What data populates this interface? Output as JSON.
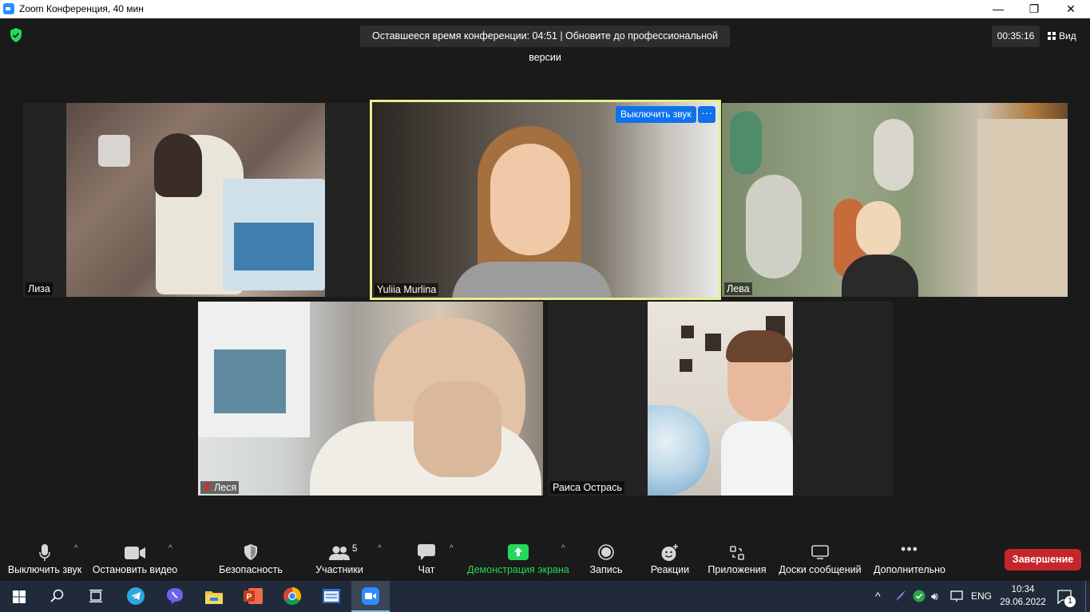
{
  "window": {
    "title": "Zoom Конференция, 40 мин",
    "minimize_glyph": "—",
    "maximize_glyph": "❐",
    "close_glyph": "✕"
  },
  "meeting": {
    "banner": "Оставшееся время конференции: 04:51 | Обновите до профессиональной версии",
    "elapsed": "00:35:16",
    "view_label": "Вид",
    "security_icon": "shield-check-icon",
    "security_color": "#23d959"
  },
  "participants": [
    {
      "name": "Лиза",
      "muted": false
    },
    {
      "name": "Yuliia Murlina",
      "muted": false,
      "active_speaker": true
    },
    {
      "name": "Лева",
      "muted": false
    },
    {
      "name": "Леся",
      "muted": true
    },
    {
      "name": "Раиса Острась",
      "muted": false
    }
  ],
  "speaker_overlay": {
    "mute_button": "Выключить звук",
    "more_button": "···"
  },
  "toolbar": {
    "audio": "Выключить звук",
    "video": "Остановить видео",
    "security": "Безопасность",
    "participants": "Участники",
    "participants_count": "5",
    "chat": "Чат",
    "share": "Демонстрация экрана",
    "record": "Запись",
    "reactions": "Реакции",
    "apps": "Приложения",
    "whiteboards": "Доски сообщений",
    "more": "Дополнительно",
    "end": "Завершение",
    "share_color": "#23d959",
    "end_color": "#c4262c"
  },
  "taskbar": {
    "language": "ENG",
    "time": "10:34",
    "date": "29.06.2022",
    "notifications": "1",
    "apps": [
      "windows-start-icon",
      "search-icon",
      "task-view-icon",
      "telegram-icon",
      "viber-icon",
      "file-explorer-icon",
      "powerpoint-icon",
      "chrome-icon",
      "notepad-icon",
      "zoom-icon"
    ]
  },
  "colors": {
    "background": "#1a1a1a",
    "accent": "#0e72ed",
    "speaker_border": "#e4f08c",
    "taskbar": "#202a3a"
  }
}
